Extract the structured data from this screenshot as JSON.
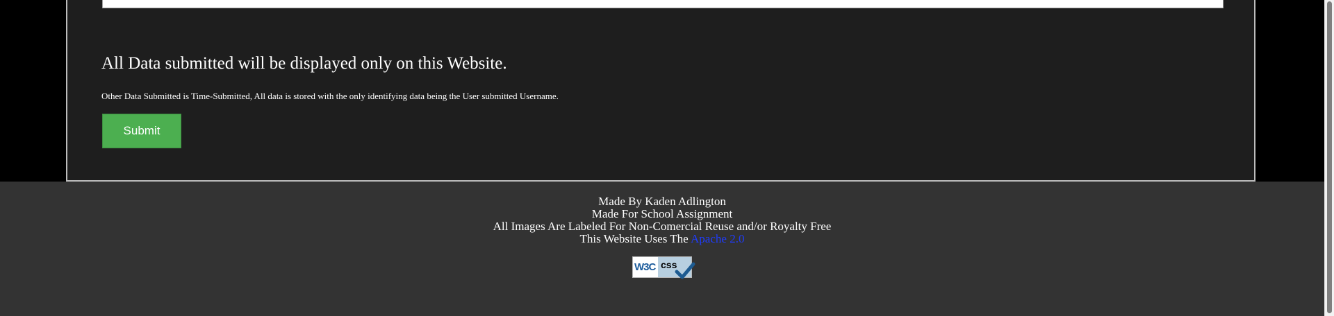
{
  "form": {
    "heading": "All Data submitted will be displayed only on this Website.",
    "note": "Other Data Submitted is Time-Submitted, All data is stored with the only identifying data being the User submitted Username.",
    "submit_label": "Submit"
  },
  "footer": {
    "line1": "Made By Kaden Adlington",
    "line2": "Made For School Assignment",
    "line3": "All Images Are Labeled For Non-Comercial Reuse and/or Royalty Free",
    "line4_prefix": "This Website Uses The ",
    "license_link": "Apache 2.0",
    "badge_w3c": "W3C",
    "badge_css": "css"
  },
  "colors": {
    "page_background": "#000000",
    "panel_background": "#1e1e1e",
    "footer_background": "#333333",
    "submit_green": "#4caf50",
    "link_blue": "#1f3cff"
  },
  "icons": {
    "badge": "w3c-css-validator-badge",
    "check": "checkmark-icon"
  }
}
